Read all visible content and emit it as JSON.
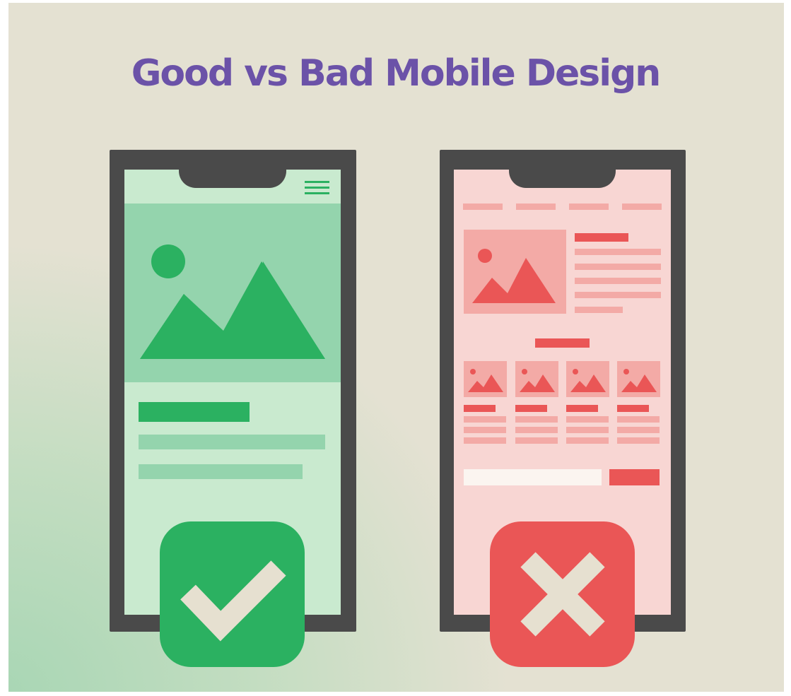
{
  "title": "Good vs Bad Mobile Design",
  "colors": {
    "title": "#6b52a8",
    "background": "#e4e1d2",
    "phone_frame": "#4a4a4a",
    "good_accent": "#2bb161",
    "good_light": "#94d4ad",
    "good_screen": "#c9eacf",
    "bad_accent": "#ea5656",
    "bad_light": "#f3aaa6",
    "bad_screen": "#f8d6d3",
    "mark": "#e6e0d0"
  },
  "good_example": {
    "icons": [
      "hamburger-menu-icon",
      "image-placeholder-icon",
      "checkmark-icon"
    ]
  },
  "bad_example": {
    "nav_items": 4,
    "thumbnails": 4,
    "icons": [
      "image-placeholder-icon",
      "cross-icon"
    ]
  }
}
